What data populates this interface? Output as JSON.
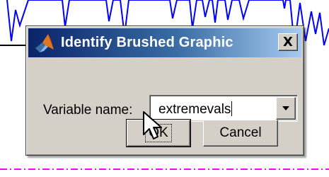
{
  "dialog": {
    "title": "Identify Brushed Graphic",
    "close_label": "X",
    "field_label": "Variable name:",
    "field_value": "extremevals",
    "ok_label": "OK",
    "cancel_label": "Cancel"
  },
  "colors": {
    "title_bar_start": "#0a246a",
    "title_bar_end": "#a6caf0",
    "dialog_face": "#d4d0c8",
    "plot_line": "#0000ff",
    "dashed_line": "#ff00ff"
  },
  "icons": {
    "app": "matlab-logo-icon",
    "dropdown": "chevron-down-icon",
    "pointer": "mouse-pointer-icon"
  }
}
